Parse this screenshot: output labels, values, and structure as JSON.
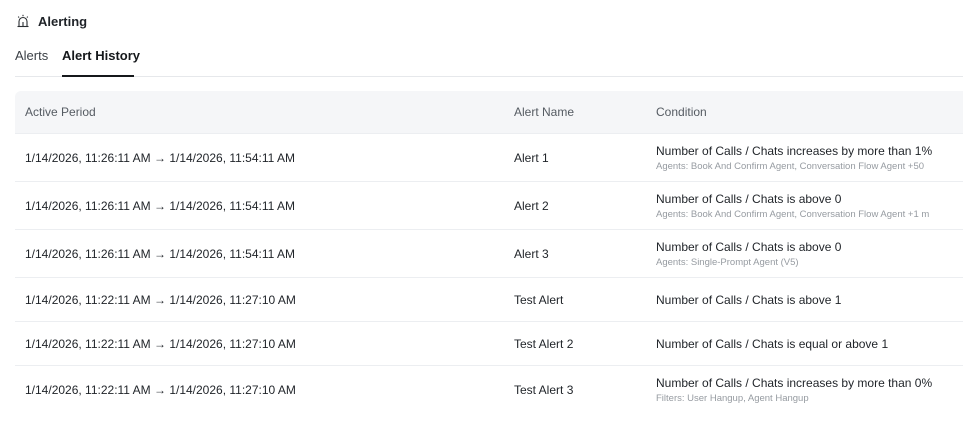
{
  "header": {
    "title": "Alerting",
    "icon": "siren-icon"
  },
  "tabs": [
    {
      "label": "Alerts",
      "active": false
    },
    {
      "label": "Alert History",
      "active": true
    }
  ],
  "table": {
    "columns": [
      "Active Period",
      "Alert Name",
      "Condition"
    ],
    "rows": [
      {
        "period": "1/14/2026, 11:26:11 AM → 1/14/2026, 11:54:11 AM",
        "name": "Alert 1",
        "condition": "Number of Calls / Chats increases by more than 1%",
        "detail": "Agents: Book And Confirm Agent, Conversation Flow Agent +50"
      },
      {
        "period": "1/14/2026, 11:26:11 AM → 1/14/2026, 11:54:11 AM",
        "name": "Alert 2",
        "condition": "Number of Calls / Chats is above 0",
        "detail": "Agents: Book And Confirm Agent, Conversation Flow Agent +1 m"
      },
      {
        "period": "1/14/2026, 11:26:11 AM → 1/14/2026, 11:54:11 AM",
        "name": "Alert 3",
        "condition": "Number of Calls / Chats is above 0",
        "detail": "Agents: Single-Prompt Agent (V5)"
      },
      {
        "period": "1/14/2026, 11:22:11 AM → 1/14/2026, 11:27:10 AM",
        "name": "Test Alert",
        "condition": "Number of Calls / Chats is above 1",
        "detail": ""
      },
      {
        "period": "1/14/2026, 11:22:11 AM → 1/14/2026, 11:27:10 AM",
        "name": "Test Alert 2",
        "condition": "Number of Calls / Chats is equal or above 1",
        "detail": ""
      },
      {
        "period": "1/14/2026, 11:22:11 AM → 1/14/2026, 11:27:10 AM",
        "name": "Test Alert 3",
        "condition": "Number of Calls / Chats increases by more than 0%",
        "detail": "Filters: User Hangup, Agent Hangup"
      }
    ]
  },
  "colors": {
    "header_bg": "#f5f6f8",
    "border": "#eceef1",
    "muted_text": "#969ba1",
    "active_tab": "#15181b"
  }
}
